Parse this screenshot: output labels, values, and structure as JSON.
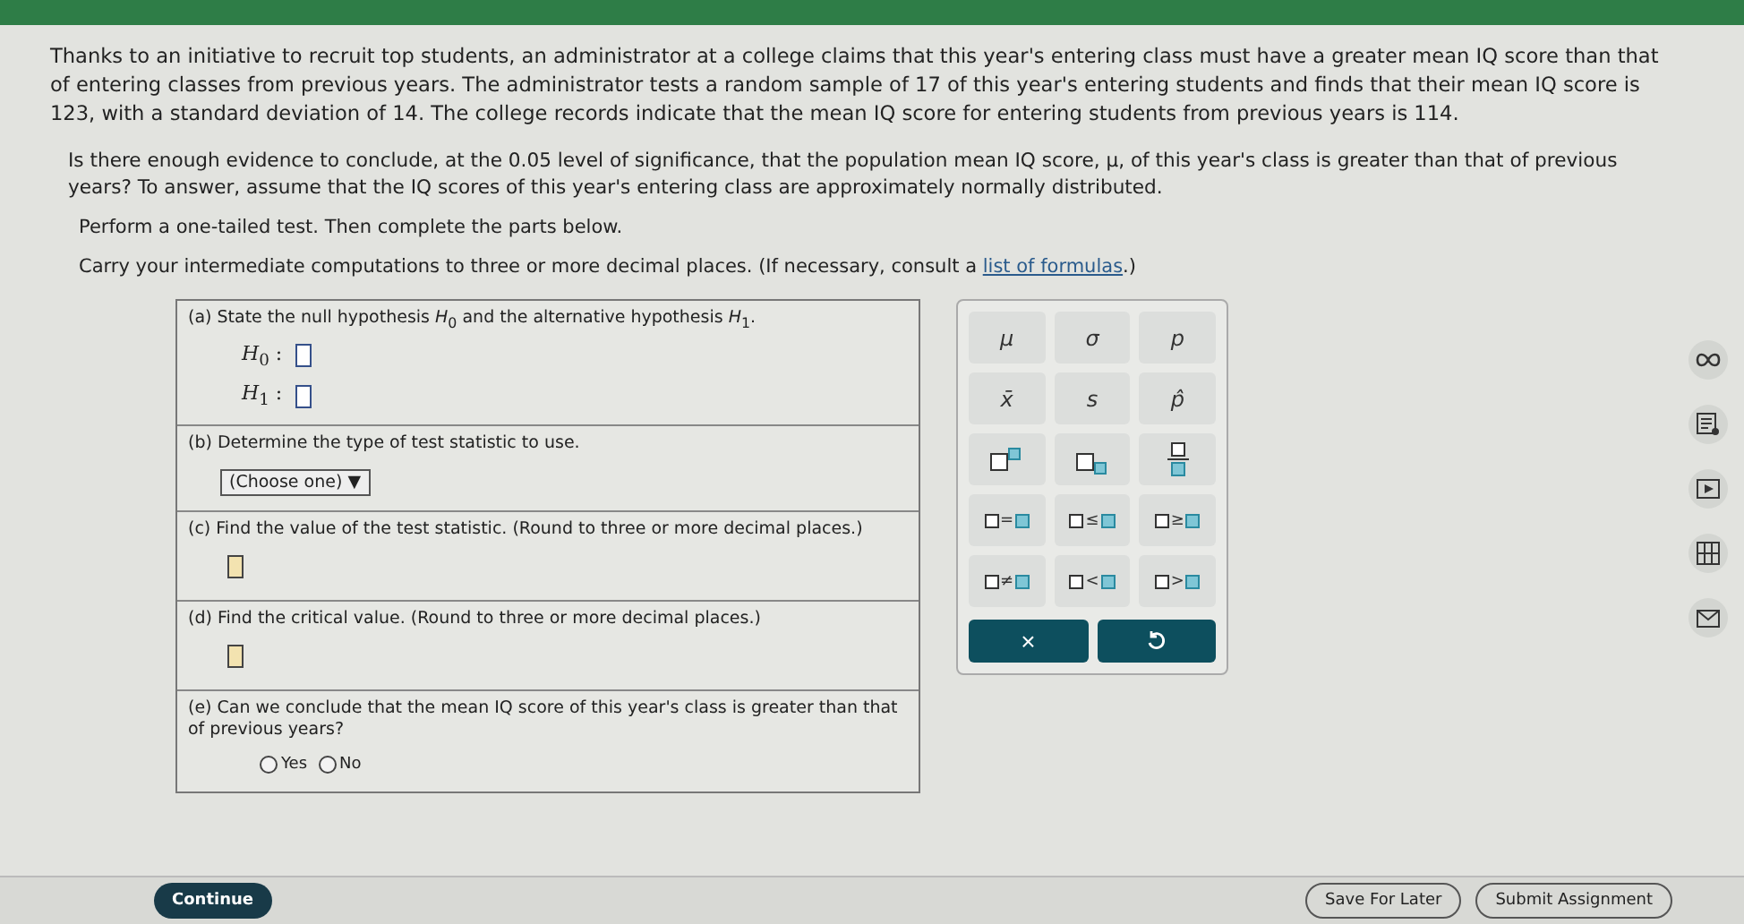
{
  "intro": [
    "Thanks to an initiative to recruit top students, an administrator at a college claims that this year's entering class must have a greater mean IQ score than that of entering classes from previous years. The administrator tests a random sample of 17 of this year's entering students and finds that their mean IQ score is 123, with a standard deviation of 14. The college records indicate that the mean IQ score for entering students from previous years is 114.",
    "Is there enough evidence to conclude, at the 0.05 level of significance, that the population mean IQ score, μ, of this year's class is greater than that of previous years? To answer, assume that the IQ scores of this year's entering class are approximately normally distributed.",
    "Perform a one-tailed test. Then complete the parts below."
  ],
  "note": {
    "text": "Carry your intermediate computations to three or more decimal places. (If necessary, consult a ",
    "link": "list of formulas",
    "after": ".)"
  },
  "parts": [
    {
      "kind": "hypotheses",
      "label": "(a)",
      "prompt": "State the null hypothesis *H*$_{0}$ and the alternative hypothesis *H*$_{1}$.",
      "rows": [
        "*H*$_{0}$ :",
        "*H*$_{1}$ :"
      ]
    },
    {
      "kind": "select",
      "label": "(b)",
      "prompt": "Determine the type of test statistic to use.",
      "choice": "(Choose one)",
      "arrow": "▼"
    },
    {
      "kind": "input",
      "label": "(c)",
      "prompt": "Find the value of the test statistic. (Round to three or more decimal places.)"
    },
    {
      "kind": "input",
      "label": "(d)",
      "prompt": "Find the critical value. (Round to three or more decimal places.)"
    },
    {
      "kind": "radio",
      "label": "(e)",
      "prompt": "Can we conclude that the mean IQ score of this year's class is greater than that of previous years?",
      "options": [
        {
          "label": "Yes",
          "selected": false
        },
        {
          "label": "No",
          "selected": false
        }
      ]
    }
  ],
  "keypad": [
    {
      "kind": "symbol",
      "label": "μ"
    },
    {
      "kind": "symbol",
      "label": "σ"
    },
    {
      "kind": "symbol",
      "label": "p"
    },
    {
      "kind": "symbol",
      "label": "x̄"
    },
    {
      "kind": "symbol",
      "label": "s"
    },
    {
      "kind": "symbol",
      "label": "p̂"
    },
    {
      "kind": "power"
    },
    {
      "kind": "subscript"
    },
    {
      "kind": "fraction"
    },
    {
      "kind": "relation",
      "label": "="
    },
    {
      "kind": "relation",
      "label": "≤"
    },
    {
      "kind": "relation",
      "label": "≥"
    },
    {
      "kind": "relation",
      "label": "≠"
    },
    {
      "kind": "relation",
      "label": "<"
    },
    {
      "kind": "relation",
      "label": ">"
    }
  ],
  "keypad_actions": [
    {
      "kind": "clear",
      "label": "×"
    },
    {
      "kind": "undo"
    }
  ],
  "footer": {
    "continue": "Continue",
    "save": "Save For Later",
    "submit": "Submit Assignment"
  }
}
